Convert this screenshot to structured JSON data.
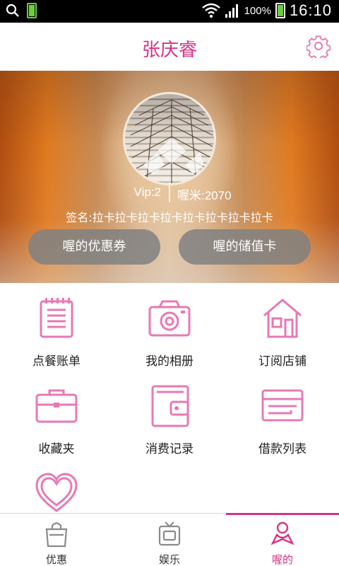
{
  "status_bar": {
    "battery_small_label": "100%",
    "battery_pct": "100%",
    "clock": "16:10"
  },
  "header": {
    "title": "张庆睿",
    "settings_icon": "gear-icon"
  },
  "profile": {
    "vip": "Vip:2",
    "points": "喔米:2070",
    "signature": "签名:拉卡拉卡拉卡拉卡拉卡拉卡拉卡拉卡",
    "coupon_button": "喔的优惠券",
    "card_button": "喔的储值卡"
  },
  "grid": {
    "items": [
      {
        "label": "点餐账单",
        "icon": "bill-icon"
      },
      {
        "label": "我的相册",
        "icon": "camera-icon"
      },
      {
        "label": "订阅店铺",
        "icon": "house-icon"
      },
      {
        "label": "收藏夹",
        "icon": "briefcase-icon"
      },
      {
        "label": "消费记录",
        "icon": "wallet-icon"
      },
      {
        "label": "借款列表",
        "icon": "card-icon"
      },
      {
        "label": "",
        "icon": "heart-icon"
      }
    ]
  },
  "tabbar": {
    "tabs": [
      {
        "label": "优惠",
        "icon": "shopping-bag-icon"
      },
      {
        "label": "娱乐",
        "icon": "tv-icon"
      },
      {
        "label": "喔的",
        "icon": "user-icon"
      }
    ],
    "active_index": 2
  },
  "colors": {
    "accent": "#d63384",
    "icon_pink": "#e879b4",
    "pill_gray": "#808080"
  }
}
